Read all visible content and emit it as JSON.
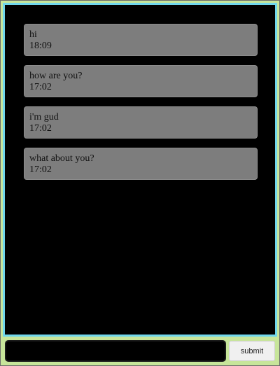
{
  "messages": [
    {
      "text": "hi",
      "time": "18:09"
    },
    {
      "text": "how are you?",
      "time": "17:02"
    },
    {
      "text": "i'm gud",
      "time": "17:02"
    },
    {
      "text": "what about you?",
      "time": "17:02"
    }
  ],
  "composer": {
    "input_value": "",
    "input_placeholder": "",
    "submit_label": "submit"
  },
  "colors": {
    "panel_border": "#6fd6ec",
    "composer_background": "#c7e59a",
    "message_background": "#7d7d7d",
    "chat_background": "#000000"
  }
}
